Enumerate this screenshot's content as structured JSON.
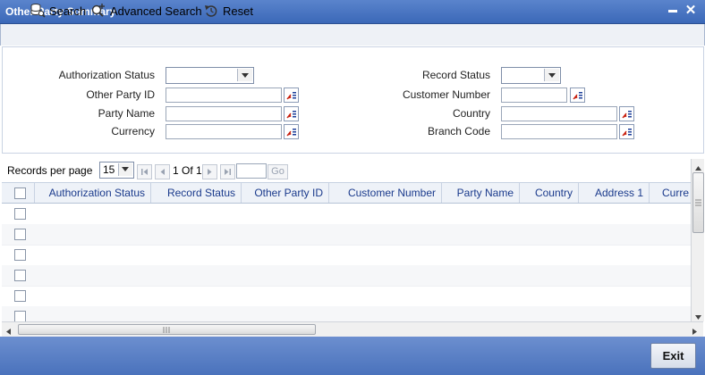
{
  "window": {
    "title": "Other Party Summary",
    "minimize_glyph": "▬",
    "close_glyph": "✕"
  },
  "toolbar": {
    "search": {
      "label": "Search",
      "icon": "database-search-icon"
    },
    "advanced_search": {
      "label": "Advanced Search",
      "icon": "advanced-search-icon"
    },
    "reset": {
      "label": "Reset",
      "icon": "reset-icon"
    }
  },
  "search_form": {
    "authorization_status": {
      "label": "Authorization Status",
      "value": ""
    },
    "record_status": {
      "label": "Record Status",
      "value": ""
    },
    "other_party_id": {
      "label": "Other Party ID",
      "value": ""
    },
    "customer_number": {
      "label": "Customer Number",
      "value": ""
    },
    "party_name": {
      "label": "Party Name",
      "value": ""
    },
    "country": {
      "label": "Country",
      "value": ""
    },
    "currency": {
      "label": "Currency",
      "value": ""
    },
    "branch_code": {
      "label": "Branch Code",
      "value": ""
    }
  },
  "pagination": {
    "records_per_page_label": "Records per page",
    "records_per_page": "15",
    "page_info": "1 Of 1",
    "page_input": "",
    "go_label": "Go"
  },
  "grid": {
    "columns": [
      "Authorization Status",
      "Record Status",
      "Other Party ID",
      "Customer Number",
      "Party Name",
      "Country",
      "Address 1",
      "Curre"
    ],
    "row_count": 6
  },
  "footer": {
    "exit_label": "Exit"
  },
  "colors": {
    "titlebar": "#3b68b8",
    "header_text": "#1a3a8c",
    "footer": "#4a72bc"
  }
}
